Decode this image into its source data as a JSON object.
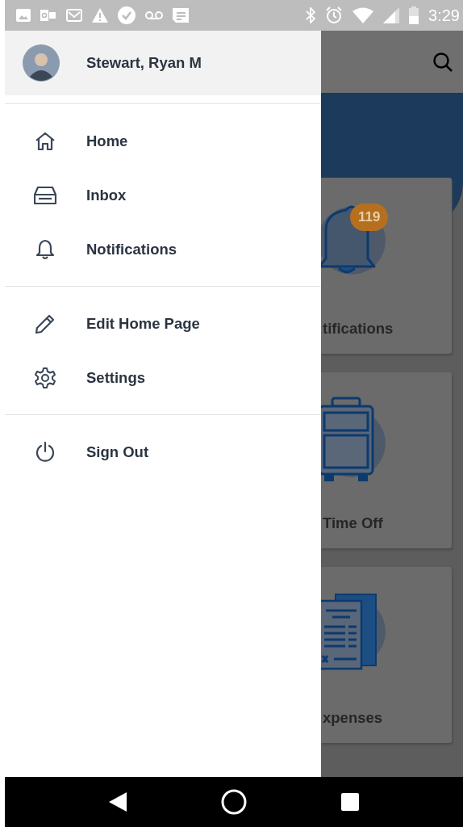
{
  "status_bar": {
    "time": "3:29"
  },
  "drawer": {
    "user_name": "Stewart, Ryan M",
    "sections": [
      {
        "items": [
          {
            "kind": "home",
            "label": "Home"
          },
          {
            "kind": "inbox",
            "label": "Inbox"
          },
          {
            "kind": "bell",
            "label": "Notifications"
          }
        ]
      },
      {
        "items": [
          {
            "kind": "pencil",
            "label": "Edit Home Page"
          },
          {
            "kind": "gear",
            "label": "Settings"
          }
        ]
      },
      {
        "items": [
          {
            "kind": "power",
            "label": "Sign Out"
          }
        ]
      }
    ]
  },
  "background": {
    "tiles": [
      {
        "kind": "bell",
        "label": "tifications",
        "badge": "119"
      },
      {
        "kind": "suitcase",
        "label": "Time Off"
      },
      {
        "kind": "receipt",
        "label": "xpenses"
      }
    ]
  }
}
